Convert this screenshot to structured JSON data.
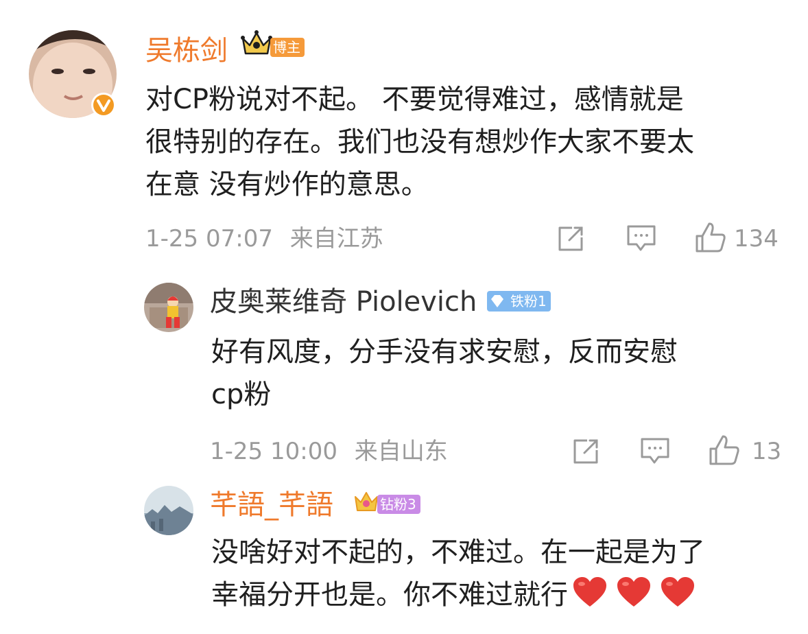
{
  "comments": [
    {
      "username": "吴栋剑",
      "badge": "博主",
      "badge_color": "#f59a3a",
      "name_color": "#ef7a2c",
      "lines": [
        "对CP粉说对不起。 不要觉得难过，感情就是",
        "很特别的存在。我们也没有想炒作大家不要太",
        "在意 没有炒作的意思。"
      ],
      "time": "1-25 07:07",
      "location": "来自江苏",
      "likes": "134"
    },
    {
      "username": "皮奥莱维奇 Piolevich",
      "badge": "铁粉1",
      "badge_color": "#7fb8f0",
      "name_color": "#333333",
      "lines": [
        "好有风度，分手没有求安慰，反而安慰",
        "cp粉"
      ],
      "time": "1-25 10:00",
      "location": "来自山东",
      "likes": "13"
    },
    {
      "username": "芊語_芊語",
      "badge": "钻粉3",
      "badge_color": "#c98be6",
      "name_color": "#ef7a2c",
      "lines": [
        "没啥好对不起的，不难过。在一起是为了",
        "幸福分开也是。你不难过就行"
      ],
      "hearts": [
        "heart-emoji",
        "heart-emoji",
        "heart-emoji"
      ]
    }
  ],
  "icons": {
    "share": "share-icon",
    "comment": "comment-icon",
    "like": "like-icon",
    "verified": "verified-icon",
    "crown": "crown-icon",
    "diamond": "diamond-icon"
  }
}
